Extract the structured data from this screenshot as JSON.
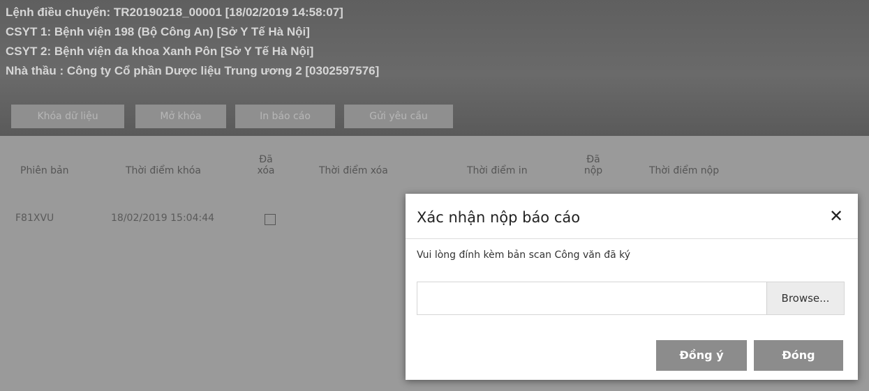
{
  "header": {
    "line1": "Lệnh điều chuyển: TR20190218_00001 [18/02/2019 14:58:07]",
    "line2": "CSYT 1: Bệnh viện 198 (Bộ Công An) [Sở Y Tế Hà Nội]",
    "line3": "CSYT 2: Bệnh viện đa khoa Xanh Pôn [Sở Y Tế Hà Nội]",
    "line4": "Nhà thầu : Công ty Cổ phần Dược liệu Trung ương 2 [0302597576]"
  },
  "toolbar": {
    "lock": "Khóa dữ liệu",
    "unlock": "Mở khóa",
    "print": "In báo cáo",
    "send": "Gửi yêu cầu"
  },
  "table": {
    "headers": {
      "version": "Phiên bản",
      "lock_time": "Thời điểm khóa",
      "deleted_1": "Đã",
      "deleted_2": "xóa",
      "delete_time": "Thời điểm xóa",
      "print_time": "Thời điểm in",
      "submitted_1": "Đã",
      "submitted_2": "nộp",
      "submit_time": "Thời điểm nộp"
    },
    "rows": [
      {
        "version": "F81XVU",
        "lock_time": "18/02/2019 15:04:44",
        "deleted": false
      }
    ]
  },
  "modal": {
    "title": "Xác nhận nộp báo cáo",
    "message": "Vui lòng đính kèm bản scan Công văn đã ký",
    "file_value": "",
    "browse": "Browse...",
    "ok": "Đồng ý",
    "close": "Đóng"
  }
}
